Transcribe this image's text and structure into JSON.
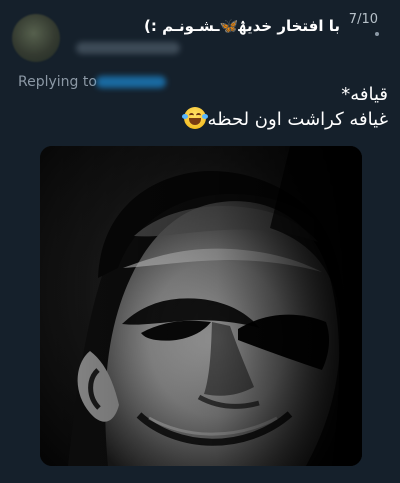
{
  "tweet": {
    "display_name": "با افتخار خدیۿ",
    "display_name_suffix": "ـشـونـم :)",
    "butterfly_icon": "butterfly-icon",
    "counter": "7/10",
    "replying_label": "Replying to",
    "text_line1": "قیافه*",
    "text_line2": "غیافه کراشت اون لحظه",
    "emoji_icon": "face-with-tears-of-joy-icon",
    "media_description": "grayscale meme image"
  },
  "colors": {
    "background": "#15202b",
    "text_primary": "#ffffff",
    "text_secondary": "#8b98a5",
    "accent": "#1d9bf0"
  }
}
